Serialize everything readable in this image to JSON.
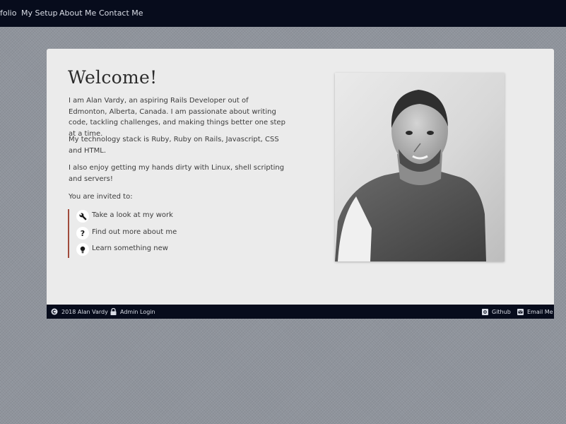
{
  "nav": {
    "items": [
      "folio",
      "My Setup",
      "About Me",
      "Contact Me"
    ]
  },
  "welcome": {
    "title": "Welcome!",
    "paragraphs": [
      "I am Alan Vardy, an aspiring Rails Developer out of Edmonton, Alberta, Canada. I am passionate about writing code, tackling challenges, and making things better one step at a time.",
      "My technology stack is Ruby, Ruby on Rails, Javascript, CSS and HTML.",
      "I also enjoy getting my hands dirty with Linux, shell scripting and servers!",
      "You are invited to:"
    ],
    "invites": [
      {
        "label": "Take a look at my work",
        "icon": "wrench-icon"
      },
      {
        "label": "Find out more about me",
        "icon": "question-icon"
      },
      {
        "label": "Learn something new",
        "icon": "lightbulb-icon"
      }
    ],
    "photo_icon": "profile-photo"
  },
  "footer": {
    "copyright": "2018 Alan Vardy",
    "admin_login": "Admin Login",
    "github": "Github",
    "email": "Email Me"
  },
  "colors": {
    "nav_bg": "#070c1c",
    "card_bg": "#ebebeb",
    "accent_border": "#a04a3b",
    "page_bg": "#8f949c"
  }
}
